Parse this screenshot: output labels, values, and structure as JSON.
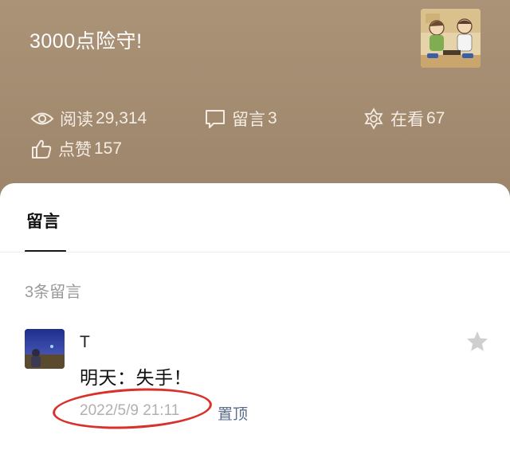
{
  "article": {
    "title": "3000点险守!"
  },
  "stats": {
    "read_label": "阅读",
    "read_count": "29,314",
    "comment_label": "留言",
    "comment_count": "3",
    "watch_label": "在看",
    "watch_count": "67",
    "like_label": "点赞",
    "like_count": "157"
  },
  "comments_panel": {
    "tab_label": "留言",
    "count_label": "3条留言",
    "items": [
      {
        "username": "T",
        "text": "明天：失手！",
        "date": "2022/5/9 21:11",
        "pin_label": "置顶"
      }
    ]
  },
  "colors": {
    "header_bg": "#a68f74",
    "annotation": "#d8302a",
    "link": "#5a6b8f"
  },
  "icons": [
    "eye-icon",
    "comment-bubble-icon",
    "watch-flower-icon",
    "thumbs-up-icon",
    "star-icon"
  ]
}
